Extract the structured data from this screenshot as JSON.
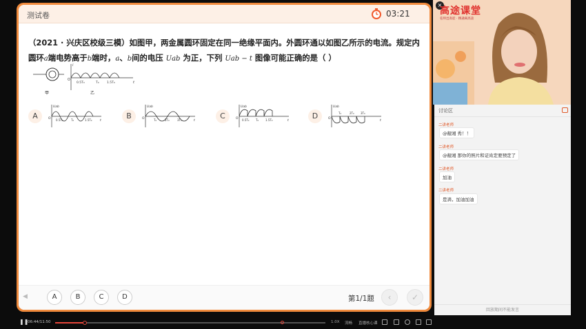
{
  "quiz": {
    "title": "测试卷",
    "timer": "03:21",
    "question_parts": {
      "p1": "（2021 · 兴庆区校级三模）如图甲，两金属圆环固定在同一绝缘平面内。外圆环通以如图乙所示的电流。规定内",
      "p2a": "圆环",
      "var_a": "a",
      "p2b": "端电势高于",
      "var_b": "b",
      "p2c": "端时，",
      "var_a2": "a",
      "p2d": "、",
      "var_b2": "b",
      "p2e": "间的电压",
      "var_uab": "Uab",
      "p2f": "为正，下列",
      "var_uabt": "Uab − t",
      "p2g": "图像可能正确的是（    ）"
    },
    "figure": {
      "label_jia": "甲",
      "label_yi": "乙",
      "axis_i": "i",
      "axis_t": "t",
      "origin": "O",
      "ticks": [
        "0.5T₀",
        "T₀",
        "1.5T₀"
      ]
    },
    "options": [
      {
        "letter": "A",
        "ticks": [
          "0.5T₀",
          "T₀",
          "1.5T₀"
        ]
      },
      {
        "letter": "B",
        "ticks": [
          "T₀",
          "2T₀",
          "3T₀"
        ]
      },
      {
        "letter": "C",
        "ticks": [
          "0.5T₀",
          "T₀",
          "1.5T₀"
        ]
      },
      {
        "letter": "D",
        "ticks": [
          "T₀",
          "2T₀",
          "3T₀"
        ]
      }
    ],
    "option_axis_y": "Uab",
    "option_axis_t": "t",
    "option_origin": "O",
    "answer_buttons": [
      "A",
      "B",
      "C",
      "D"
    ],
    "page_info": "第1/1题",
    "colors": {
      "accent": "#f08a3c",
      "header_bg": "#fdf0e6"
    }
  },
  "video": {
    "logo": "高途课堂",
    "logo_sub": "名师出高徒 · 精通离高途",
    "close_icon": "close-icon"
  },
  "chat": {
    "title": "讨论区",
    "messages": [
      {
        "name": "二讲老师",
        "text": "@靓湘 秀！！"
      },
      {
        "name": "二讲老师",
        "text": "@靓湘 那你的照片和证肯定要预定了"
      },
      {
        "name": "二讲老师",
        "text": "加油"
      },
      {
        "name": "二讲老师",
        "text": "是滴，加油加油"
      }
    ],
    "input_placeholder": "回放期间不能发言"
  },
  "player": {
    "time": "06:44/11:50",
    "progress": 0.11,
    "marker_pos": 0.84,
    "label_speed": "1.0X",
    "label_clarity": "流畅",
    "label_mode": "直播核心课"
  }
}
